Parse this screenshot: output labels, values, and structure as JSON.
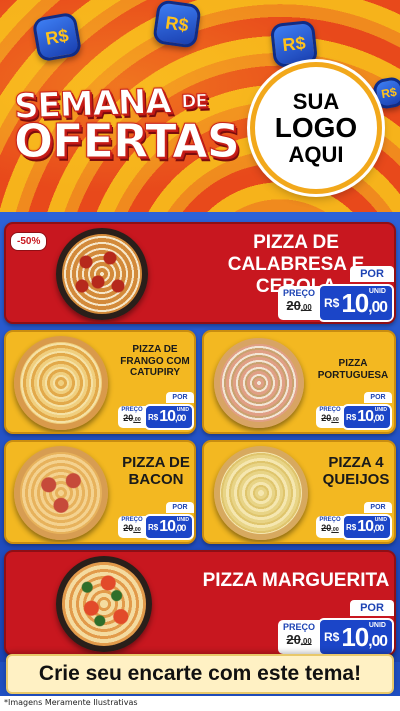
{
  "header": {
    "coin_symbol": "R$",
    "title_line1": "SEMANA",
    "title_de": "DE",
    "title_line2": "OFERTAS",
    "logo": {
      "line1": "SUA",
      "line2": "LOGO",
      "line3": "AQUI"
    }
  },
  "price_labels": {
    "preco": "PREÇO",
    "por": "POR",
    "unid": "UNID",
    "currency": "R$"
  },
  "products": [
    {
      "name": "PIZZA DE CALABRESA E CEBOLA",
      "badge": "-50%",
      "old_int": "20",
      "old_dec": ",00",
      "price_int": "10",
      "price_dec": ",00"
    },
    {
      "name": "PIZZA DE FRANGO COM CATUPIRY",
      "old_int": "20",
      "old_dec": ",00",
      "price_int": "10",
      "price_dec": ",00"
    },
    {
      "name": "PIZZA PORTUGUESA",
      "old_int": "20",
      "old_dec": ",00",
      "price_int": "10",
      "price_dec": ",00"
    },
    {
      "name": "PIZZA DE BACON",
      "old_int": "20",
      "old_dec": ",00",
      "price_int": "10",
      "price_dec": ",00"
    },
    {
      "name": "PIZZA 4 QUEIJOS",
      "old_int": "20",
      "old_dec": ",00",
      "price_int": "10",
      "price_dec": ",00"
    },
    {
      "name": "PIZZA MARGUERITA",
      "old_int": "20",
      "old_dec": ",00",
      "price_int": "10",
      "price_dec": ",00"
    }
  ],
  "cta": "Crie seu encarte com este tema!",
  "disclaimer": "*Imagens Meramente Ilustrativas",
  "colors": {
    "red": "#c8171f",
    "yellow": "#f3b821",
    "blue": "#1b45c8",
    "orange": "#e8491b"
  }
}
